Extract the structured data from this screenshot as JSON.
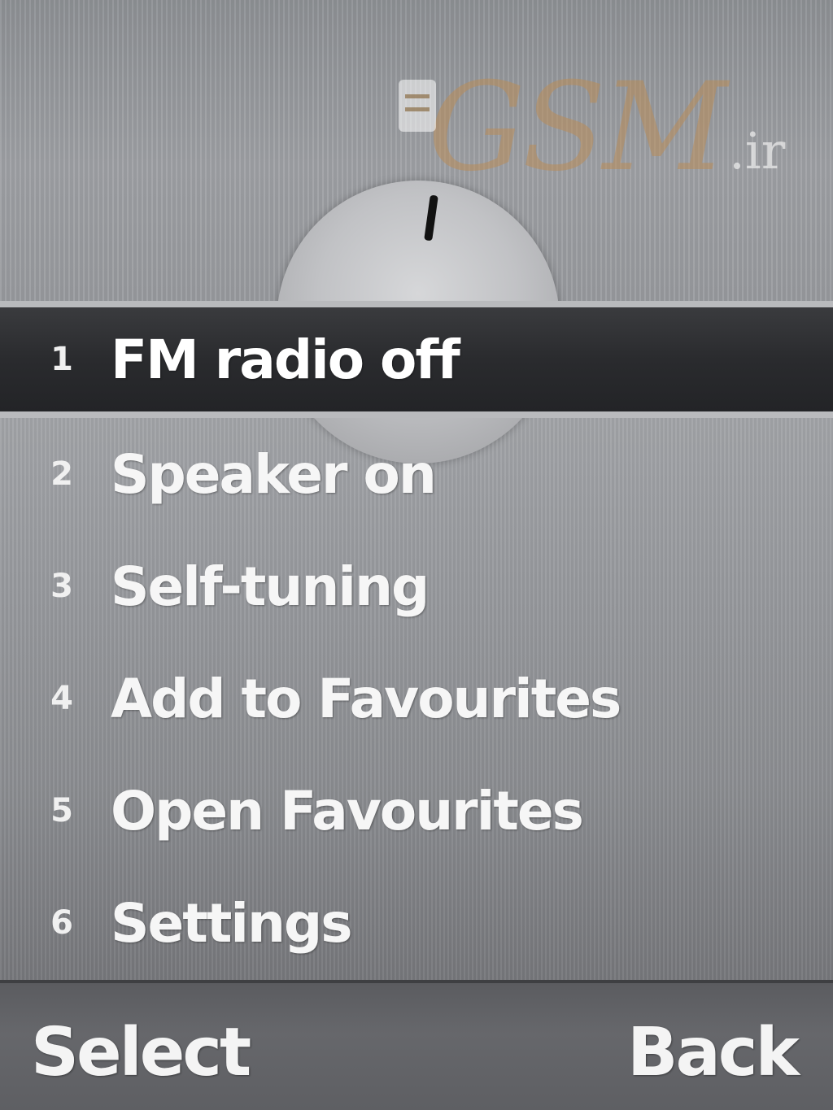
{
  "header": {
    "watermark_text": "GSM",
    "watermark_suffix": ".ir",
    "dial_icon": "radio-dial-icon"
  },
  "menu": {
    "selected_index": 0,
    "items": [
      {
        "number": "1",
        "label": "FM radio off"
      },
      {
        "number": "2",
        "label": "Speaker on"
      },
      {
        "number": "3",
        "label": "Self-tuning"
      },
      {
        "number": "4",
        "label": "Add to Favourites"
      },
      {
        "number": "5",
        "label": "Open Favourites"
      },
      {
        "number": "6",
        "label": "Settings"
      }
    ]
  },
  "softkeys": {
    "left_label": "Select",
    "right_label": "Back"
  },
  "colors": {
    "highlight": "#2a2b2e",
    "background": "#9ea0a4",
    "watermark": "#ba8c58"
  }
}
